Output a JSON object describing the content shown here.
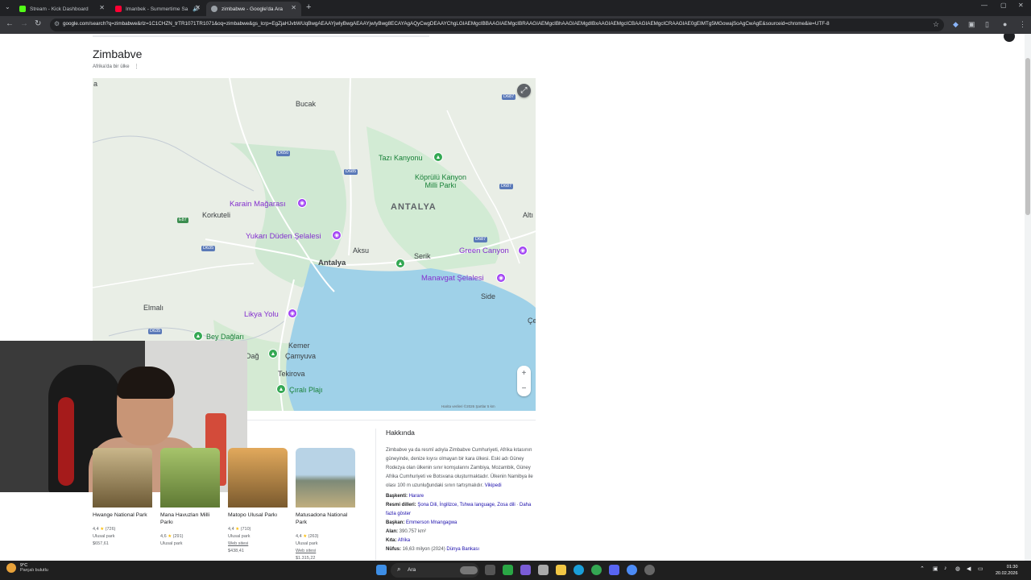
{
  "browser": {
    "tabs": [
      {
        "title": "Stream - Kick Dashboard",
        "color": "#53fc18"
      },
      {
        "title": "Imanbek - Summertime Sa",
        "color": "#ff0033"
      },
      {
        "title": "zimbabwe - Google'da Ara",
        "color": "#9aa0a6"
      }
    ],
    "url": "google.com/search?q=zimbabwe&rlz=1C1CHZN_trTR1071TR1071&oq=zimbabwe&gs_lcrp=EgZjaHJvbWUqBwgAEAAYjwIyBwgAEAAYjwIyBwg8ECAYAgAQyCwgDEAAYChgLGIAEMgcIBBAAGIAEMgcIBRAAGIAEMgcIBhAAGIAEMgdIBxAAGIAEMgcICBAAGIAEMgcICRAAGIAE0gEIMTg5MGowajSoAgCwAgE&sourceid=chrome&ie=UTF-8"
  },
  "entity": {
    "title": "Zimbabve",
    "subtitle": "Afrika'da bir ülke",
    "more": "⋮"
  },
  "map": {
    "labels": {
      "bucak": "Bucak",
      "antalya_region": "ANTALYA",
      "antalya_city": "Antalya",
      "korkuteli": "Korkuteli",
      "aksu": "Aksu",
      "serik": "Serik",
      "elmali": "Elmalı",
      "kemer": "Kemer",
      "camyuva": "Çamyuva",
      "tekirova": "Tekirova",
      "side": "Side",
      "alt": "Altı",
      "ce": "Çe",
      "dag": "Dağ",
      "a": "a"
    },
    "pois": {
      "karain": "Karain Mağarası",
      "yukari_duden": "Yukarı Düden Şelalesi",
      "green_canyon": "Green Canyon",
      "manavgat": "Manavgat Şelalesi",
      "likya": "Likya Yolu",
      "tazi": "Tazı Kanyonu",
      "koprulu": "Köprülü Kanyon Milli Parkı",
      "bey": "Bey Dağları",
      "cirali": "Çıralı Plajı"
    },
    "roads": [
      "D650",
      "D685",
      "D687",
      "D687",
      "D687",
      "E87",
      "D635",
      "D635"
    ],
    "footer": "Harita verileri ©2026   Şartlar   5 km"
  },
  "cards": [
    {
      "name": "Hwange National Park",
      "rating": "4,4",
      "count": "(726)",
      "kind": "Ulusal park",
      "price": "$657,61",
      "site": ""
    },
    {
      "name": "Mana Havuzları Milli Parkı",
      "rating": "4,6",
      "count": "(291)",
      "kind": "",
      "price": "",
      "site": "Ulusal park"
    },
    {
      "name": "Matopo Ulusal Parkı",
      "rating": "4,4",
      "count": "(710)",
      "kind": "Ulusal park",
      "price": "$438,41",
      "site": "Web sitesi"
    },
    {
      "name": "Matusadona National Park",
      "rating": "4,4",
      "count": "(263)",
      "kind": "Ulusal park",
      "price": "$1.315,22",
      "site": "Web sitesi"
    }
  ],
  "about": {
    "heading": "Hakkında",
    "description": "Zimbabve ya da resmî adıyla Zimbabve Cumhuriyeti, Afrika kıtasının güneyinde, denize kıyısı olmayan bir kara ülkesi. Eski adı Güney Rodezya olan ülkenin sınır komşularını Zambiya, Mozambik, Güney Afrika Cumhuriyeti ve Botsvana oluşturmaktadır. Ülkenin Namibya ile olası 100 m uzunluğundaki sınırı tartışmalıdır.",
    "source": "Vikipedi",
    "facts": {
      "capital_label": "Başkenti:",
      "capital": "Harare",
      "languages_label": "Resmi dilleri:",
      "languages": "Şona Dili, İngilizce, Tshwa language, Zosa dili",
      "languages_more": "Daha fazla göster",
      "president_label": "Başkan:",
      "president": "Emmerson Mnangagwa",
      "area_label": "Alan:",
      "area": "390.757 km²",
      "continent_label": "Kıta:",
      "continent": "Afrika",
      "population_label": "Nüfus:",
      "population": "16,63 milyon (2024)",
      "population_source": "Dünya Bankası"
    }
  },
  "taskbar": {
    "weather_temp": "9°C",
    "weather_desc": "Parçalı bulutlu",
    "search": "Ara",
    "time": "01:30",
    "date": "20.02.2026"
  }
}
